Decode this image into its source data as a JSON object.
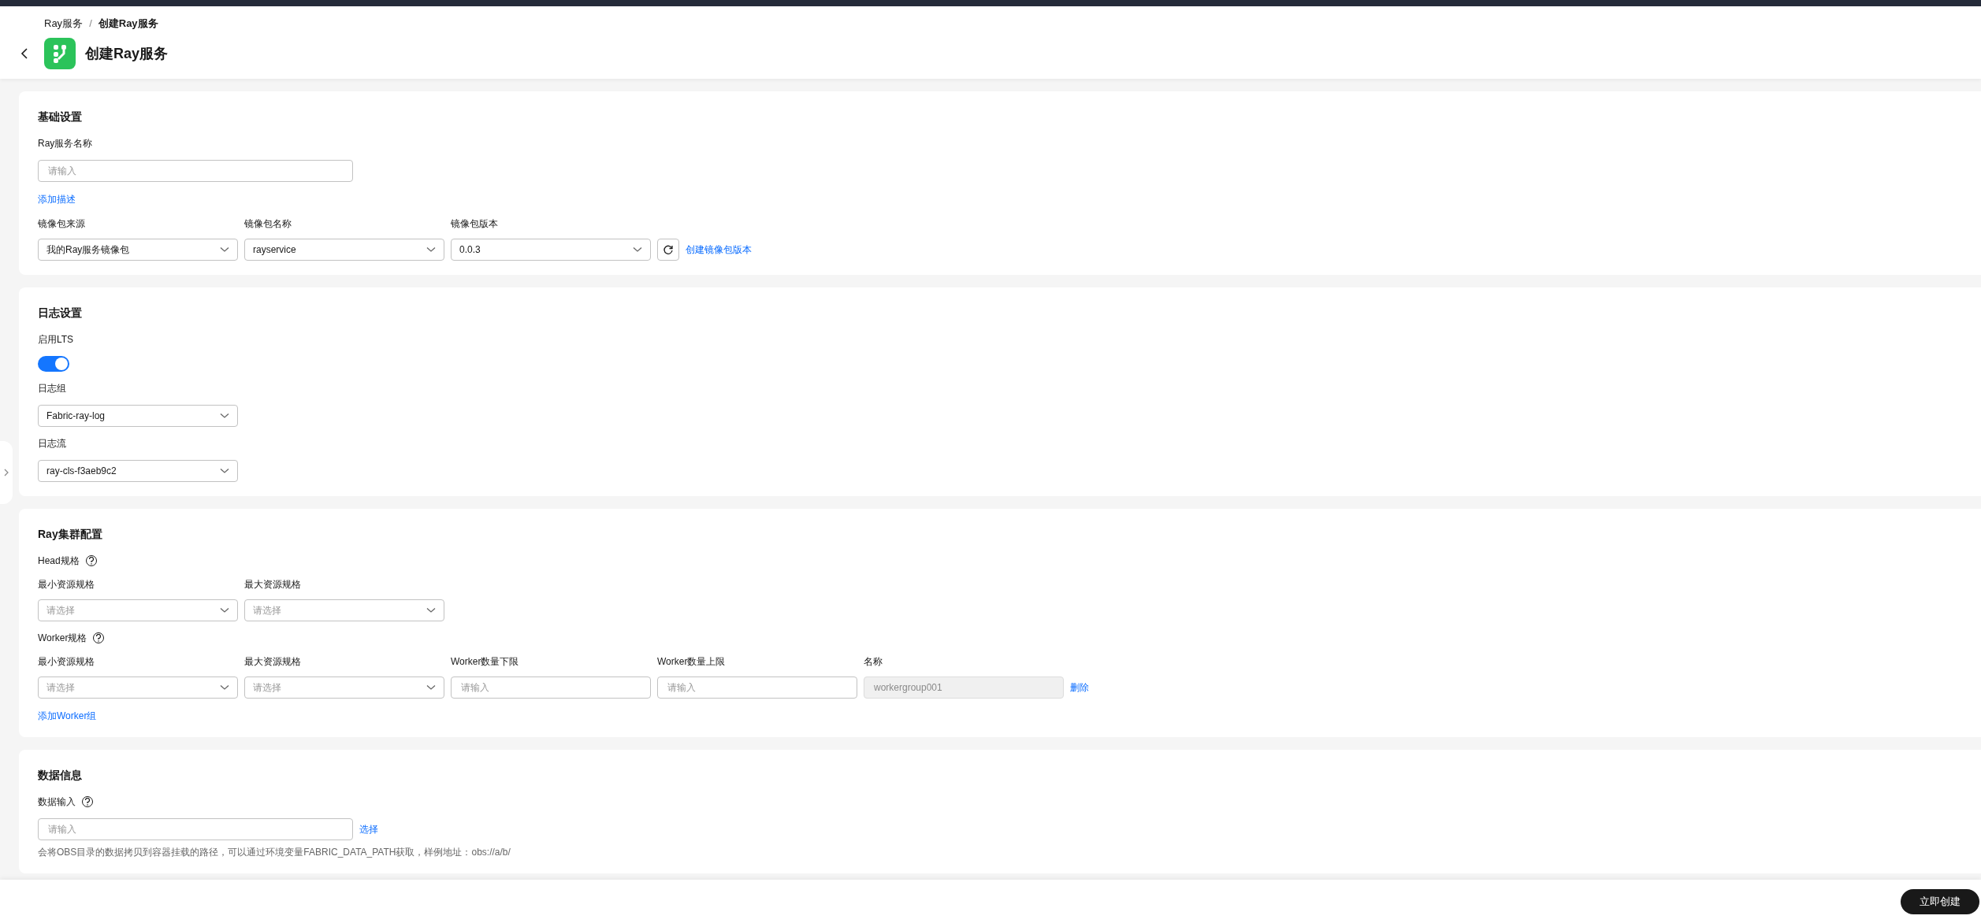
{
  "breadcrumb": [
    "Ray服务",
    "创建Ray服务"
  ],
  "breadcrumb_separator": "/",
  "title": "创建Ray服务",
  "sections": [
    {
      "title": "基础设置",
      "items": [
        {
          "kind": "label",
          "text": "Ray服务名称",
          "help": false
        },
        {
          "kind": "row",
          "fields": [
            {
              "kind": "long-input",
              "placeholder": "请输入"
            }
          ]
        },
        {
          "kind": "link",
          "text": "添加描述"
        },
        {
          "kind": "row",
          "fields": [
            {
              "kind": "select",
              "label": "镜像包来源",
              "value": "我的Ray服务镜像包"
            },
            {
              "kind": "select",
              "label": "镜像包名称",
              "value": "rayservice"
            },
            {
              "kind": "select",
              "label": "镜像包版本",
              "value": "0.0.3"
            },
            {
              "kind": "refresh"
            },
            {
              "kind": "link",
              "text": "创建镜像包版本"
            }
          ]
        }
      ]
    },
    {
      "title": "日志设置",
      "items": [
        {
          "kind": "label",
          "text": "启用LTS",
          "help": false
        },
        {
          "kind": "toggle",
          "on": true
        },
        {
          "kind": "label",
          "text": "日志组",
          "help": false
        },
        {
          "kind": "row",
          "fields": [
            {
              "kind": "select",
              "value": "Fabric-ray-log"
            }
          ]
        },
        {
          "kind": "label",
          "text": "日志流",
          "help": false
        },
        {
          "kind": "row",
          "fields": [
            {
              "kind": "select",
              "value": "ray-cls-f3aeb9c2"
            }
          ]
        }
      ]
    },
    {
      "title": "Ray集群配置",
      "items": [
        {
          "kind": "label",
          "text": "Head规格",
          "help": true
        },
        {
          "kind": "row",
          "fields": [
            {
              "kind": "select",
              "label": "最小资源规格",
              "placeholder": "请选择"
            },
            {
              "kind": "select",
              "label": "最大资源规格",
              "placeholder": "请选择"
            }
          ]
        },
        {
          "kind": "label",
          "text": "Worker规格",
          "help": true
        },
        {
          "kind": "row",
          "fields": [
            {
              "kind": "select",
              "label": "最小资源规格",
              "placeholder": "请选择"
            },
            {
              "kind": "select",
              "label": "最大资源规格",
              "placeholder": "请选择"
            },
            {
              "kind": "input",
              "label": "Worker数量下限",
              "placeholder": "请输入"
            },
            {
              "kind": "input",
              "label": "Worker数量上限",
              "placeholder": "请输入"
            },
            {
              "kind": "disabled-input",
              "label": "名称",
              "value": "workergroup001"
            },
            {
              "kind": "link",
              "text": "删除"
            }
          ]
        },
        {
          "kind": "link",
          "text": "添加Worker组"
        }
      ]
    },
    {
      "title": "数据信息",
      "items": [
        {
          "kind": "label",
          "text": "数据输入",
          "help": true
        },
        {
          "kind": "row",
          "fields": [
            {
              "kind": "long-input",
              "placeholder": "请输入"
            },
            {
              "kind": "link",
              "text": "选择"
            }
          ]
        },
        {
          "kind": "note",
          "text": "会将OBS目录的数据拷贝到容器挂载的路径，可以通过环境变量FABRIC_DATA_PATH获取，样例地址：obs://a/b/"
        }
      ]
    }
  ],
  "submit": "立即创建"
}
